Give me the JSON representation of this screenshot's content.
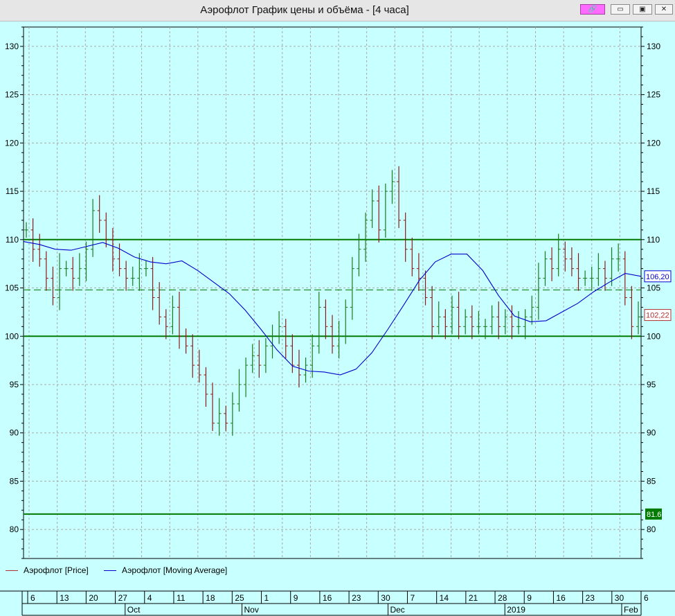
{
  "window": {
    "title": "Аэрофлот График цены и объёма - [4 часа]",
    "buttons": [
      {
        "name": "pin-button",
        "symbol": "🔗"
      },
      {
        "name": "minimize-button",
        "symbol": "▭"
      },
      {
        "name": "maximize-button",
        "symbol": "▣"
      },
      {
        "name": "close-button",
        "symbol": "✕"
      }
    ]
  },
  "legend": {
    "price_label": "Аэрофлот [Price]",
    "ma_label": "Аэрофлот [Moving Average]"
  },
  "colors": {
    "background": "#c8ffff",
    "price": "#8b1a1a",
    "price_up": "#1a7a1a",
    "moving_average": "#0000cc",
    "level_line": "#007a00",
    "grid": "#a0a0a0"
  },
  "timeline": {
    "days": [
      "6",
      "13",
      "20",
      "27",
      "4",
      "11",
      "18",
      "25",
      "1",
      "9",
      "16",
      "23",
      "30",
      "7",
      "14",
      "21",
      "28",
      "9",
      "16",
      "23",
      "30",
      "6"
    ],
    "months": [
      "Oct",
      "Nov",
      "Dec",
      "2019",
      "Feb"
    ]
  },
  "chart_data": {
    "type": "line",
    "ylim": [
      77,
      132
    ],
    "grid": true,
    "y_ticks": [
      80,
      85,
      90,
      95,
      100,
      105,
      110,
      115,
      120,
      125,
      130
    ],
    "x_month_labels": [
      "Oct",
      "Nov",
      "Dec",
      "2019",
      "Feb"
    ],
    "x_day_labels": [
      "6",
      "13",
      "20",
      "27",
      "4",
      "11",
      "18",
      "25",
      "1",
      "9",
      "16",
      "23",
      "30",
      "7",
      "14",
      "21",
      "28",
      "9",
      "16",
      "23",
      "30",
      "6"
    ],
    "series": [
      {
        "name": "Аэрофлот [Price]",
        "style": "ohlc-bars",
        "approx_close": [
          111,
          109,
          108,
          106,
          104,
          107,
          107,
          106,
          107,
          109,
          113,
          112,
          110,
          108,
          107,
          106,
          106,
          107,
          107,
          104,
          102,
          101,
          103,
          100,
          99,
          97,
          96,
          94,
          91,
          92,
          91,
          93,
          95,
          97,
          98,
          97,
          99,
          100,
          101,
          99,
          97,
          96,
          97,
          99,
          103,
          101,
          99,
          100,
          103,
          107,
          109,
          112,
          114,
          111,
          115,
          116,
          112,
          109,
          107,
          106,
          104,
          101,
          102,
          101,
          103,
          101,
          102,
          101,
          101,
          101,
          102,
          101,
          102,
          101,
          101,
          102,
          103,
          106,
          108,
          107,
          109,
          108,
          107,
          106,
          106,
          106,
          107,
          106,
          108,
          108,
          104,
          101,
          102
        ],
        "last_value_label": "102,22"
      },
      {
        "name": "Аэрофлот [Moving Average]",
        "approx_values": [
          109.8,
          109.5,
          109.0,
          108.9,
          109.3,
          109.7,
          109.1,
          108.2,
          107.7,
          107.5,
          107.8,
          106.8,
          105.6,
          104.4,
          102.7,
          100.7,
          98.6,
          96.9,
          96.4,
          96.3,
          96.0,
          96.6,
          98.3,
          100.7,
          103.2,
          105.8,
          107.7,
          108.5,
          108.5,
          106.8,
          104.2,
          102.1,
          101.5,
          101.6,
          102.5,
          103.4,
          104.6,
          105.6,
          106.5,
          106.2
        ],
        "last_value_label": "106,20"
      }
    ],
    "levels": [
      {
        "value": 110,
        "style": "solid",
        "label": ""
      },
      {
        "value": 104.8,
        "style": "dashed",
        "label": ""
      },
      {
        "value": 100,
        "style": "solid",
        "label": ""
      },
      {
        "value": 81.6,
        "style": "solid",
        "label": "81.6"
      }
    ]
  }
}
